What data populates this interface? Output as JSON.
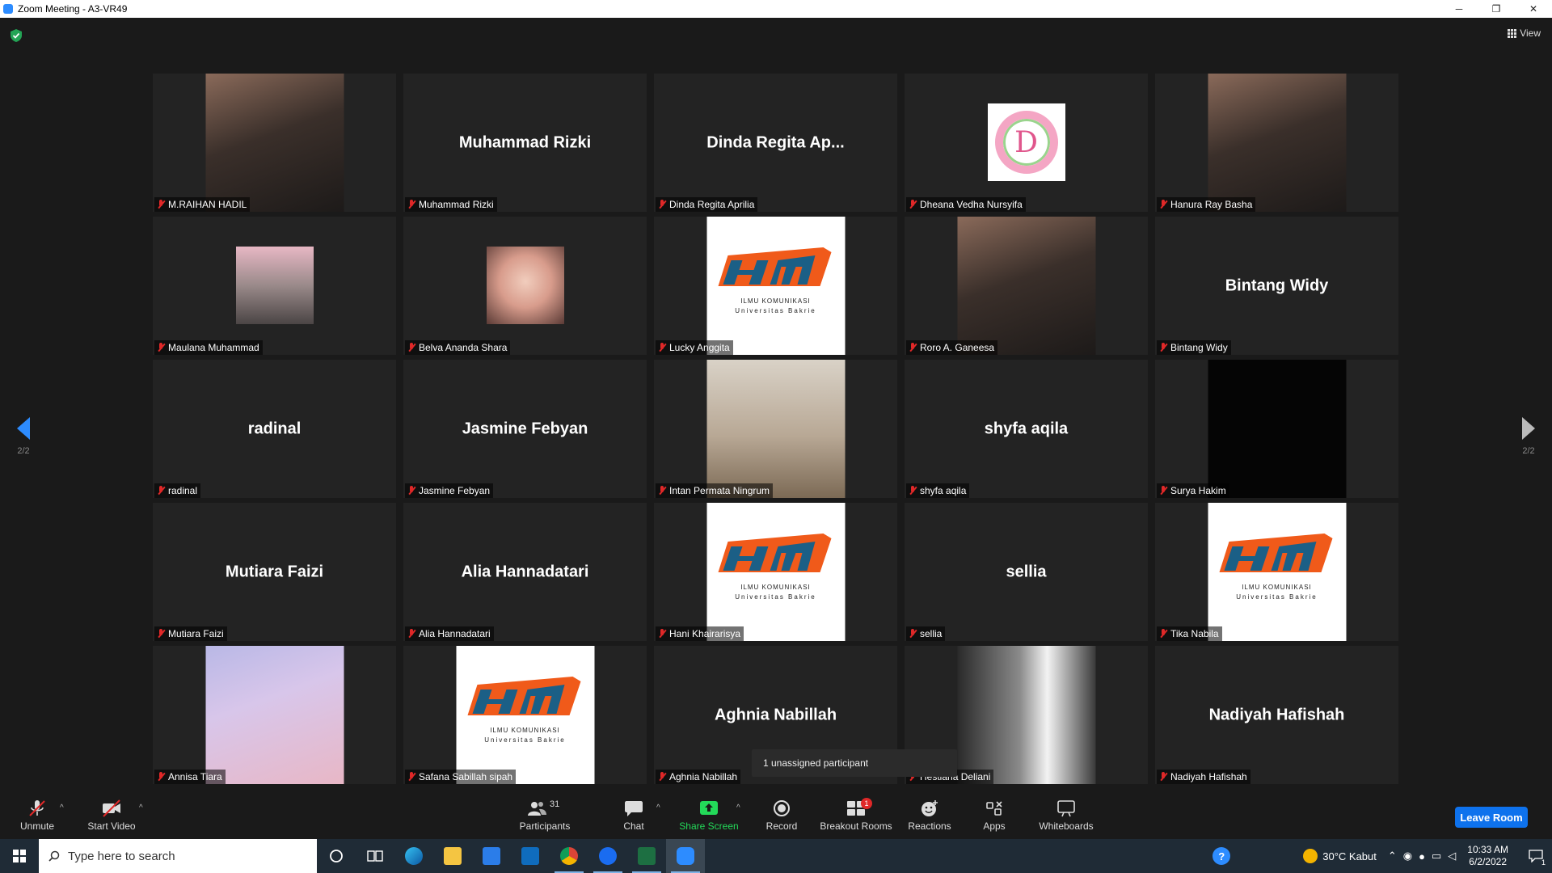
{
  "window": {
    "title": "Zoom Meeting - A3-VR49",
    "minimize": "─",
    "restore": "❐",
    "close": "✕"
  },
  "view_button": "View",
  "page_indicator_left": "2/2",
  "page_indicator_right": "2/2",
  "participants": [
    {
      "label": "M.RAIHAN HADIL",
      "display": "",
      "image": "photo"
    },
    {
      "label": "Muhammad Rizki",
      "display": "Muhammad Rizki",
      "image": ""
    },
    {
      "label": "Dinda Regita Aprilia",
      "display": "Dinda Regita Ap...",
      "image": ""
    },
    {
      "label": "Dheana Vedha Nursyifa",
      "display": "",
      "image": "wreath"
    },
    {
      "label": "Hanura Ray Basha",
      "display": "",
      "image": "photo"
    },
    {
      "label": "Maulana Muhammad",
      "display": "",
      "image": "photo-small"
    },
    {
      "label": "Belva Ananda Shara",
      "display": "",
      "image": "face-small"
    },
    {
      "label": "Lucky Anggita",
      "display": "",
      "image": "logo"
    },
    {
      "label": "Roro A. Ganeesa",
      "display": "",
      "image": "photo"
    },
    {
      "label": "Bintang Widy",
      "display": "Bintang Widy",
      "image": ""
    },
    {
      "label": "radinal",
      "display": "radinal",
      "image": ""
    },
    {
      "label": "Jasmine Febyan",
      "display": "Jasmine Febyan",
      "image": ""
    },
    {
      "label": "Intan Permata Ningrum",
      "display": "",
      "image": "museum"
    },
    {
      "label": "shyfa aqila",
      "display": "shyfa aqila",
      "image": ""
    },
    {
      "label": "Surya Hakim",
      "display": "",
      "image": "black"
    },
    {
      "label": "Mutiara Faizi",
      "display": "Mutiara Faizi",
      "image": ""
    },
    {
      "label": "Alia Hannadatari",
      "display": "Alia Hannadatari",
      "image": ""
    },
    {
      "label": "Hani Khairarisya",
      "display": "",
      "image": "logo"
    },
    {
      "label": "sellia",
      "display": "sellia",
      "image": ""
    },
    {
      "label": "Tika Nabila",
      "display": "",
      "image": "logo"
    },
    {
      "label": "Annisa Tiara",
      "display": "",
      "image": "sky"
    },
    {
      "label": "Safana Sabillah sipah",
      "display": "",
      "image": "logo"
    },
    {
      "label": "Aghnia Nabillah",
      "display": "Aghnia Nabillah",
      "image": ""
    },
    {
      "label": "Hestiana Deliani",
      "display": "",
      "image": "window"
    },
    {
      "label": "Nadiyah Hafishah",
      "display": "Nadiyah Hafishah",
      "image": ""
    }
  ],
  "logo_text": {
    "line1": "ILMU KOMUNIKASI",
    "line2": "Universitas Bakrie"
  },
  "toast": "1 unassigned participant",
  "toolbar": {
    "unmute": "Unmute",
    "start_video": "Start Video",
    "participants": "Participants",
    "participants_count": "31",
    "chat": "Chat",
    "share_screen": "Share Screen",
    "record": "Record",
    "breakout_rooms": "Breakout Rooms",
    "breakout_badge": "1",
    "reactions": "Reactions",
    "apps": "Apps",
    "whiteboards": "Whiteboards",
    "leave": "Leave Room"
  },
  "taskbar": {
    "search_placeholder": "Type here to search",
    "weather": "30°C  Kabut",
    "time": "10:33 AM",
    "date": "6/2/2022",
    "notifications": "1"
  },
  "colors": {
    "accent": "#2d8cff",
    "leave": "#0e72ed",
    "muted": "#e02828",
    "share": "#23d959",
    "logo_blue": "#1b5f86",
    "logo_orange": "#f05a1a"
  }
}
